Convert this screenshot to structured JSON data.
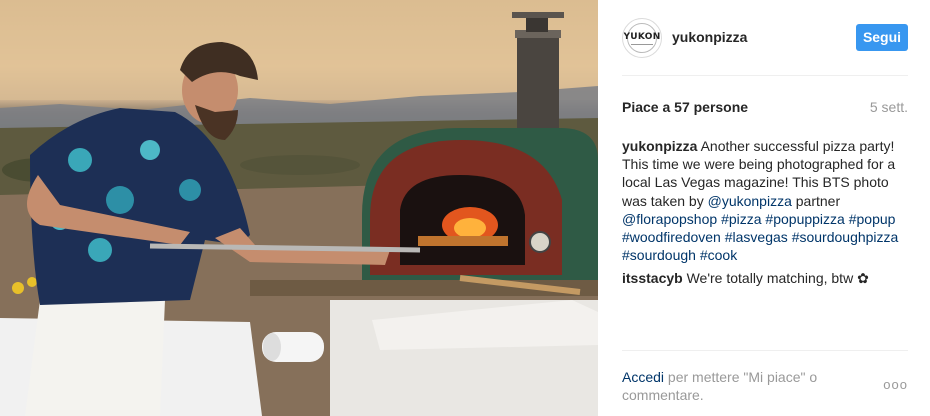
{
  "post": {
    "username": "yukonpizza",
    "avatar_text": "YUKON",
    "follow_label": "Segui",
    "likes_label": "Piace a 57 persone",
    "time_ago": "5 sett.",
    "caption": {
      "author": "yukonpizza",
      "text_1": " Another successful pizza party! This time we were being photographed for a local Las Vegas magazine! This BTS photo was taken by ",
      "mention_1": "@yukonpizza",
      "text_2": " partner ",
      "mention_2": "@florapopshop",
      "hashtags": [
        "#pizza",
        "#popuppizza",
        "#popup",
        "#woodfiredoven",
        "#lasvegas",
        "#sourdoughpizza",
        "#sourdough",
        "#cook"
      ]
    },
    "comment": {
      "author": "itsstacyb",
      "text": " We're totally matching, btw ✿"
    },
    "login_prompt": {
      "link": "Accedi",
      "text": " per mettere \"Mi piace\" o commentare."
    },
    "more_label": "ooo"
  },
  "colors": {
    "accent": "#3897f0",
    "link": "#003569",
    "muted": "#999999"
  }
}
